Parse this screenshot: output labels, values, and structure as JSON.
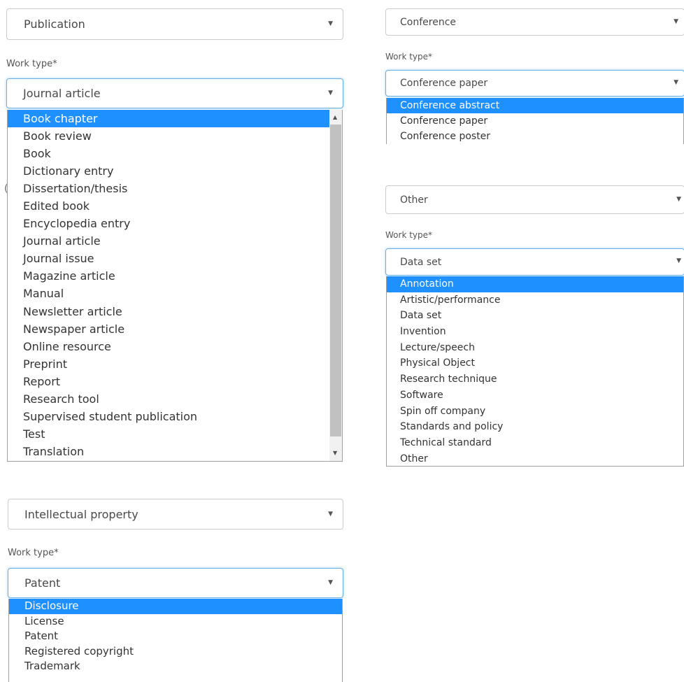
{
  "panel1": {
    "category": "Publication",
    "worktype_label": "Work type*",
    "worktype_value": "Journal article",
    "options": [
      "Book chapter",
      "Book review",
      "Book",
      "Dictionary entry",
      "Dissertation/thesis",
      "Edited book",
      "Encyclopedia entry",
      "Journal article",
      "Journal issue",
      "Magazine article",
      "Manual",
      "Newsletter article",
      "Newspaper article",
      "Online resource",
      "Preprint",
      "Report",
      "Research tool",
      "Supervised student publication",
      "Test",
      "Translation"
    ],
    "highlighted": "Book chapter"
  },
  "panel2": {
    "category": "Conference",
    "worktype_label": "Work type*",
    "worktype_value": "Conference paper",
    "options": [
      "Conference abstract",
      "Conference paper",
      "Conference poster"
    ],
    "highlighted": "Conference abstract"
  },
  "panel3": {
    "category": "Other",
    "worktype_label": "Work type*",
    "worktype_value": "Data set",
    "options": [
      "Annotation",
      "Artistic/performance",
      "Data set",
      "Invention",
      "Lecture/speech",
      "Physical Object",
      "Research technique",
      "Software",
      "Spin off company",
      "Standards and policy",
      "Technical standard",
      "Other"
    ],
    "highlighted": "Annotation"
  },
  "panel4": {
    "category": "Intellectual property",
    "worktype_label": "Work type*",
    "worktype_value": "Patent",
    "options": [
      "Disclosure",
      "License",
      "Patent",
      "Registered copyright",
      "Trademark"
    ],
    "highlighted": "Disclosure"
  },
  "icons": {
    "caret": "caret-down-icon",
    "scroll_up": "scroll-up-arrow-icon",
    "scroll_down": "scroll-down-arrow-icon"
  },
  "colors": {
    "highlight": "#1e90ff",
    "focus_border": "#66afe9",
    "border": "#cccccc"
  }
}
